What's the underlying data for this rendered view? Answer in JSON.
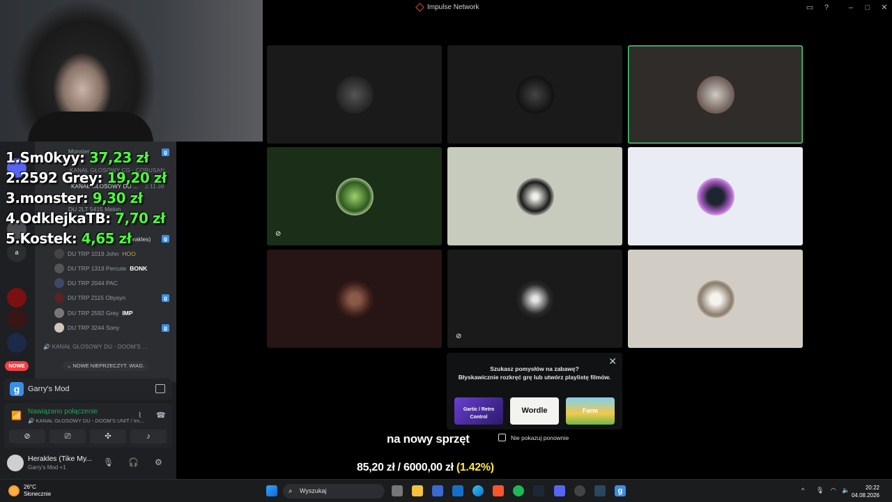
{
  "window": {
    "title": "Impulse Network"
  },
  "leaderboard": [
    {
      "rank_name": "1.Sm0kyy:",
      "amount": "37,23 zł"
    },
    {
      "rank_name": "2.2592 Grey:",
      "amount": "19,20 zł"
    },
    {
      "rank_name": "3.monster:",
      "amount": "9,30 zł"
    },
    {
      "rank_name": "4.OdklejkaTB:",
      "amount": "7,70 zł"
    },
    {
      "rank_name": "5.Kostek:",
      "amount": "4,65 zł"
    }
  ],
  "sidebar": {
    "guild_letter": "a",
    "new_badge": "NOWE",
    "unread_label": "NOWE NIEPRZECZYT. WIAD.",
    "background_rows": {
      "monster": "Monster",
      "kanal_cg": "KANAŁ GŁOSOWY CG - CORUSAN...",
      "kanal_du_top": "KANAŁ GŁOSOWY DU ...",
      "melon": "DU 2LT 5415 Melon",
      "herakles": "Herakles)",
      "timer": "2:11:38"
    },
    "voice_users": [
      {
        "name": "DU TRP 1019 John",
        "tag": "HOO"
      },
      {
        "name": "DU TRP 1319 Percute",
        "tag": "BONK"
      },
      {
        "name": "DU TRP 2044 PAC",
        "tag": ""
      },
      {
        "name": "DU TRP 2115 Obysyn",
        "tag": ""
      },
      {
        "name": "DU TRP 2592 Grey",
        "tag": "IMP"
      },
      {
        "name": "DU TRP 3244 Sony",
        "tag": ""
      }
    ],
    "channel_doom": "KANAŁ GŁOSOWY DU - DOOM'S ..."
  },
  "activity": {
    "game": "Garry's Mod"
  },
  "voice": {
    "status": "Nawiązano połączenie",
    "channel": "KANAŁ GŁOSOWY DU - DOOM'S UNIT / Im..."
  },
  "user": {
    "name": "Herakles (Tike My...",
    "status": "Garry's Mod +1"
  },
  "popup": {
    "line1": "Szukasz pomysłów na zabawę?",
    "line2": "Błyskawicznie rozkręć grę lub utwórz playlistę filmów.",
    "games": [
      "Gartic / Retro Control",
      "Wordle",
      "Farm"
    ],
    "dont_show": "Nie pokazuj ponownie"
  },
  "caption": "na nowy sprzęt",
  "goal": {
    "amount": "85,20 zł / 6000,00 zł",
    "percent": "(1.42%)"
  },
  "taskbar": {
    "temp": "26°C",
    "weather": "Słonecznie",
    "search": "Wyszukaj",
    "time": "20:22",
    "date": "04.08.2026"
  },
  "colors": {
    "donation_green": "#4cff3a",
    "speaking": "#43d17b",
    "goal_yellow": "#ffe93b"
  },
  "icons": [
    "windows-start-icon",
    "search-icon",
    "discord-icon",
    "steam-icon",
    "spotify-icon",
    "brave-icon",
    "edge-icon",
    "folder-icon"
  ]
}
